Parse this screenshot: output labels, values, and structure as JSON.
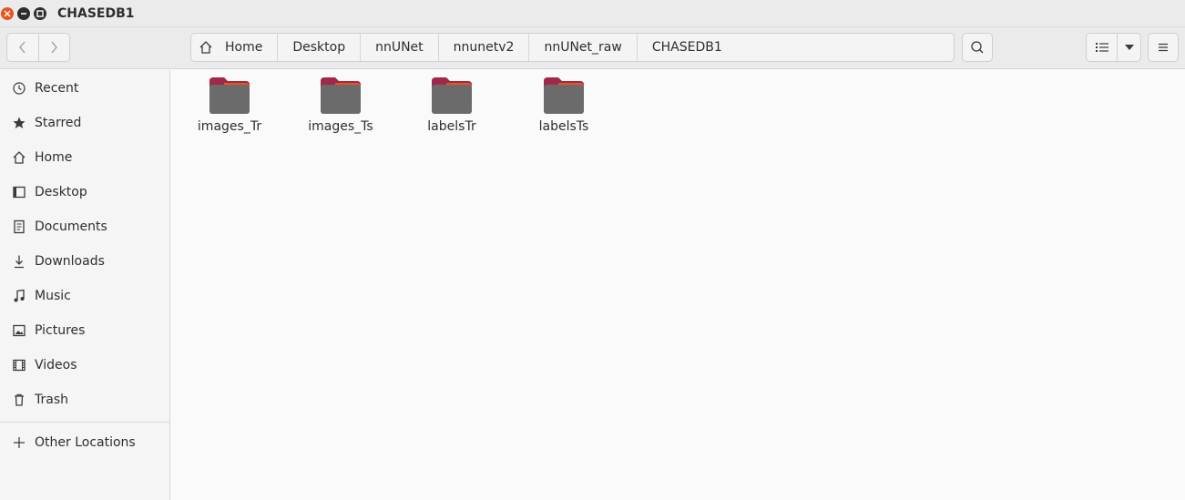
{
  "window": {
    "title": "CHASEDB1"
  },
  "pathbar": {
    "crumbs": [
      "Home",
      "Desktop",
      "nnUNet",
      "nnunetv2",
      "nnUNet_raw",
      "CHASEDB1"
    ]
  },
  "sidebar": {
    "items": [
      {
        "label": "Recent",
        "icon": "clock-icon"
      },
      {
        "label": "Starred",
        "icon": "star-icon"
      },
      {
        "label": "Home",
        "icon": "home-icon"
      },
      {
        "label": "Desktop",
        "icon": "desktop-icon"
      },
      {
        "label": "Documents",
        "icon": "document-icon"
      },
      {
        "label": "Downloads",
        "icon": "download-icon"
      },
      {
        "label": "Music",
        "icon": "music-icon"
      },
      {
        "label": "Pictures",
        "icon": "picture-icon"
      },
      {
        "label": "Videos",
        "icon": "video-icon"
      },
      {
        "label": "Trash",
        "icon": "trash-icon"
      }
    ],
    "other_locations": "Other Locations"
  },
  "files": [
    {
      "name": "images_Tr",
      "type": "folder"
    },
    {
      "name": "images_Ts",
      "type": "folder"
    },
    {
      "name": "labelsTr",
      "type": "folder"
    },
    {
      "name": "labelsTs",
      "type": "folder"
    }
  ],
  "colors": {
    "accent": "#e95420",
    "folder_body": "#6b6b6b",
    "folder_tab": "#a0294a"
  }
}
